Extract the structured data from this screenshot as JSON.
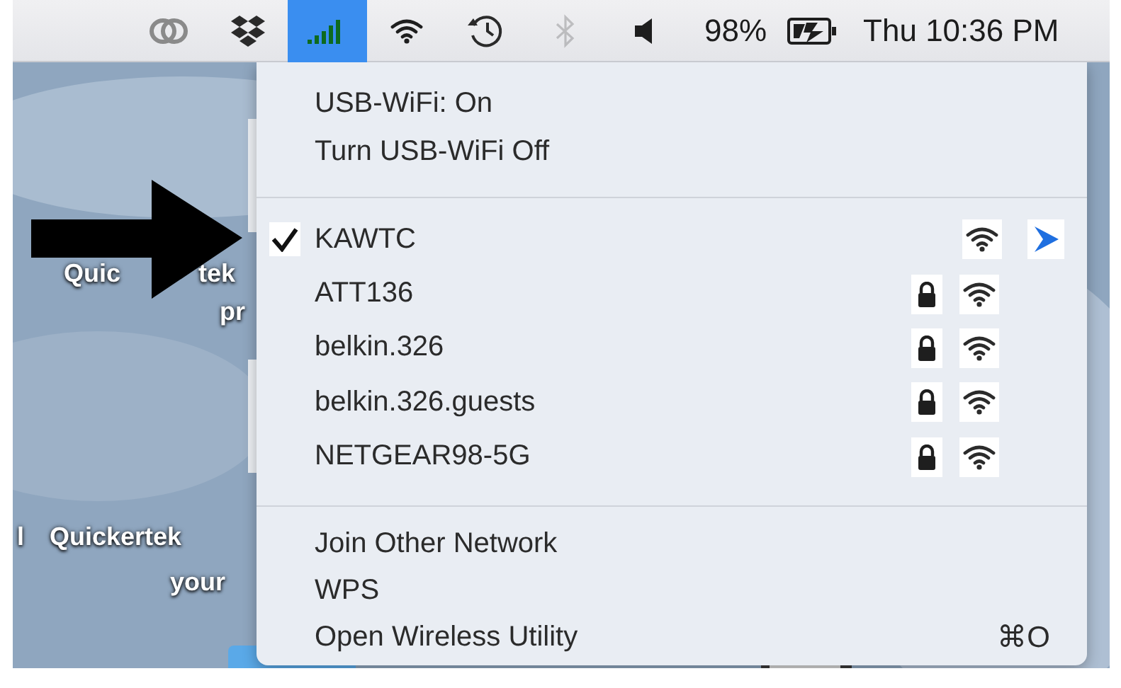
{
  "menubar": {
    "icons": [
      {
        "kind": "cloud",
        "selected": false,
        "disabled": false
      },
      {
        "kind": "dropbox",
        "selected": false,
        "disabled": false
      },
      {
        "kind": "signal",
        "selected": true,
        "disabled": false
      },
      {
        "kind": "wifi",
        "selected": false,
        "disabled": false
      },
      {
        "kind": "clock",
        "selected": false,
        "disabled": false
      },
      {
        "kind": "bluetooth",
        "selected": false,
        "disabled": true
      },
      {
        "kind": "speaker",
        "selected": false,
        "disabled": false
      }
    ],
    "battery_percent": "98%",
    "clock": "Thu 10:36 PM"
  },
  "desktop": {
    "labels": [
      {
        "text": "Quic"
      },
      {
        "text": "tek"
      },
      {
        "text": "pr"
      },
      {
        "text": "l"
      },
      {
        "text": "Quickertek"
      },
      {
        "text": "your"
      }
    ]
  },
  "menu": {
    "status": [
      {
        "label": "USB-WiFi: On"
      },
      {
        "label": "Turn USB-WiFi Off"
      }
    ],
    "networks": [
      {
        "name": "KAWTC",
        "selected": true,
        "locked": false,
        "expandable": true
      },
      {
        "name": "ATT136",
        "selected": false,
        "locked": true,
        "expandable": false
      },
      {
        "name": "belkin.326",
        "selected": false,
        "locked": true,
        "expandable": false
      },
      {
        "name": "belkin.326.guests",
        "selected": false,
        "locked": true,
        "expandable": false
      },
      {
        "name": "NETGEAR98-5G",
        "selected": false,
        "locked": true,
        "expandable": false
      }
    ],
    "actions": [
      {
        "label": "Join Other Network"
      },
      {
        "label": "WPS"
      },
      {
        "label": "Open Wireless Utility",
        "shortcut": "⌘O"
      }
    ]
  }
}
